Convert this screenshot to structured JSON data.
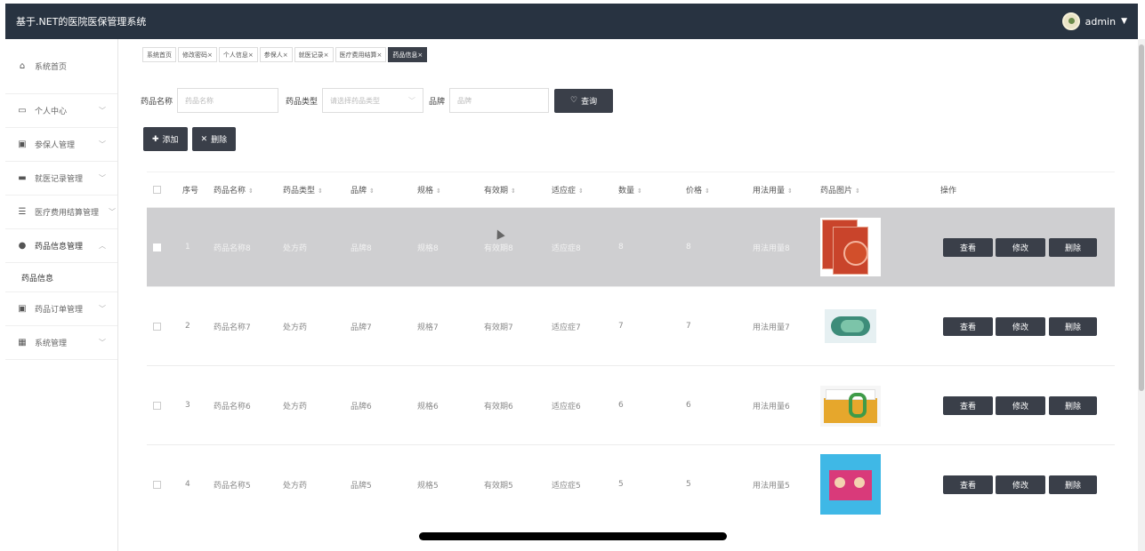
{
  "header": {
    "title": "基于.NET的医院医保管理系统",
    "user": "admin"
  },
  "sidebar": {
    "items": [
      {
        "label": "系统首页",
        "icon": "home-icon"
      },
      {
        "label": "个人中心",
        "icon": "calendar-icon"
      },
      {
        "label": "参保人管理",
        "icon": "clipboard-icon"
      },
      {
        "label": "就医记录管理",
        "icon": "monitor-icon"
      },
      {
        "label": "医疗费用结算管理",
        "icon": "sliders-icon"
      },
      {
        "label": "药品信息管理",
        "icon": "user-icon"
      },
      {
        "label": "药品订单管理",
        "icon": "clipboard-icon"
      },
      {
        "label": "系统管理",
        "icon": "grid-icon"
      }
    ],
    "sub_item": "药品信息"
  },
  "tabs": [
    {
      "label": "系统首页"
    },
    {
      "label": "修改密码×"
    },
    {
      "label": "个人信息×"
    },
    {
      "label": "参保人×"
    },
    {
      "label": "就医记录×"
    },
    {
      "label": "医疗费用结算×"
    },
    {
      "label": "药品信息×"
    }
  ],
  "search": {
    "name_label": "药品名称",
    "name_placeholder": "药品名称",
    "type_label": "药品类型",
    "type_placeholder": "请选择药品类型",
    "brand_label": "品牌",
    "brand_placeholder": "品牌",
    "query_button": "查询"
  },
  "actions": {
    "add": "添加",
    "delete": "删除"
  },
  "table": {
    "headers": [
      "序号",
      "药品名称",
      "药品类型",
      "品牌",
      "规格",
      "有效期",
      "适应症",
      "数量",
      "价格",
      "用法用量",
      "药品图片",
      "操作"
    ],
    "rows": [
      {
        "no": "1",
        "name": "药品名称8",
        "type": "处方药",
        "brand": "品牌8",
        "spec": "规格8",
        "expiry": "有效期8",
        "indication": "适应症8",
        "qty": "8",
        "price": "8",
        "usage": "用法用量8"
      },
      {
        "no": "2",
        "name": "药品名称7",
        "type": "处方药",
        "brand": "品牌7",
        "spec": "规格7",
        "expiry": "有效期7",
        "indication": "适应症7",
        "qty": "7",
        "price": "7",
        "usage": "用法用量7"
      },
      {
        "no": "3",
        "name": "药品名称6",
        "type": "处方药",
        "brand": "品牌6",
        "spec": "规格6",
        "expiry": "有效期6",
        "indication": "适应症6",
        "qty": "6",
        "price": "6",
        "usage": "用法用量6"
      },
      {
        "no": "4",
        "name": "药品名称5",
        "type": "处方药",
        "brand": "品牌5",
        "spec": "规格5",
        "expiry": "有效期5",
        "indication": "适应症5",
        "qty": "5",
        "price": "5",
        "usage": "用法用量5"
      }
    ],
    "row_actions": {
      "view": "查看",
      "edit": "修改",
      "delete": "删除"
    }
  },
  "colors": {
    "header_bg": "#283341",
    "button_bg": "#3a3f49",
    "selected_row_bg": "#cfcfd1"
  }
}
